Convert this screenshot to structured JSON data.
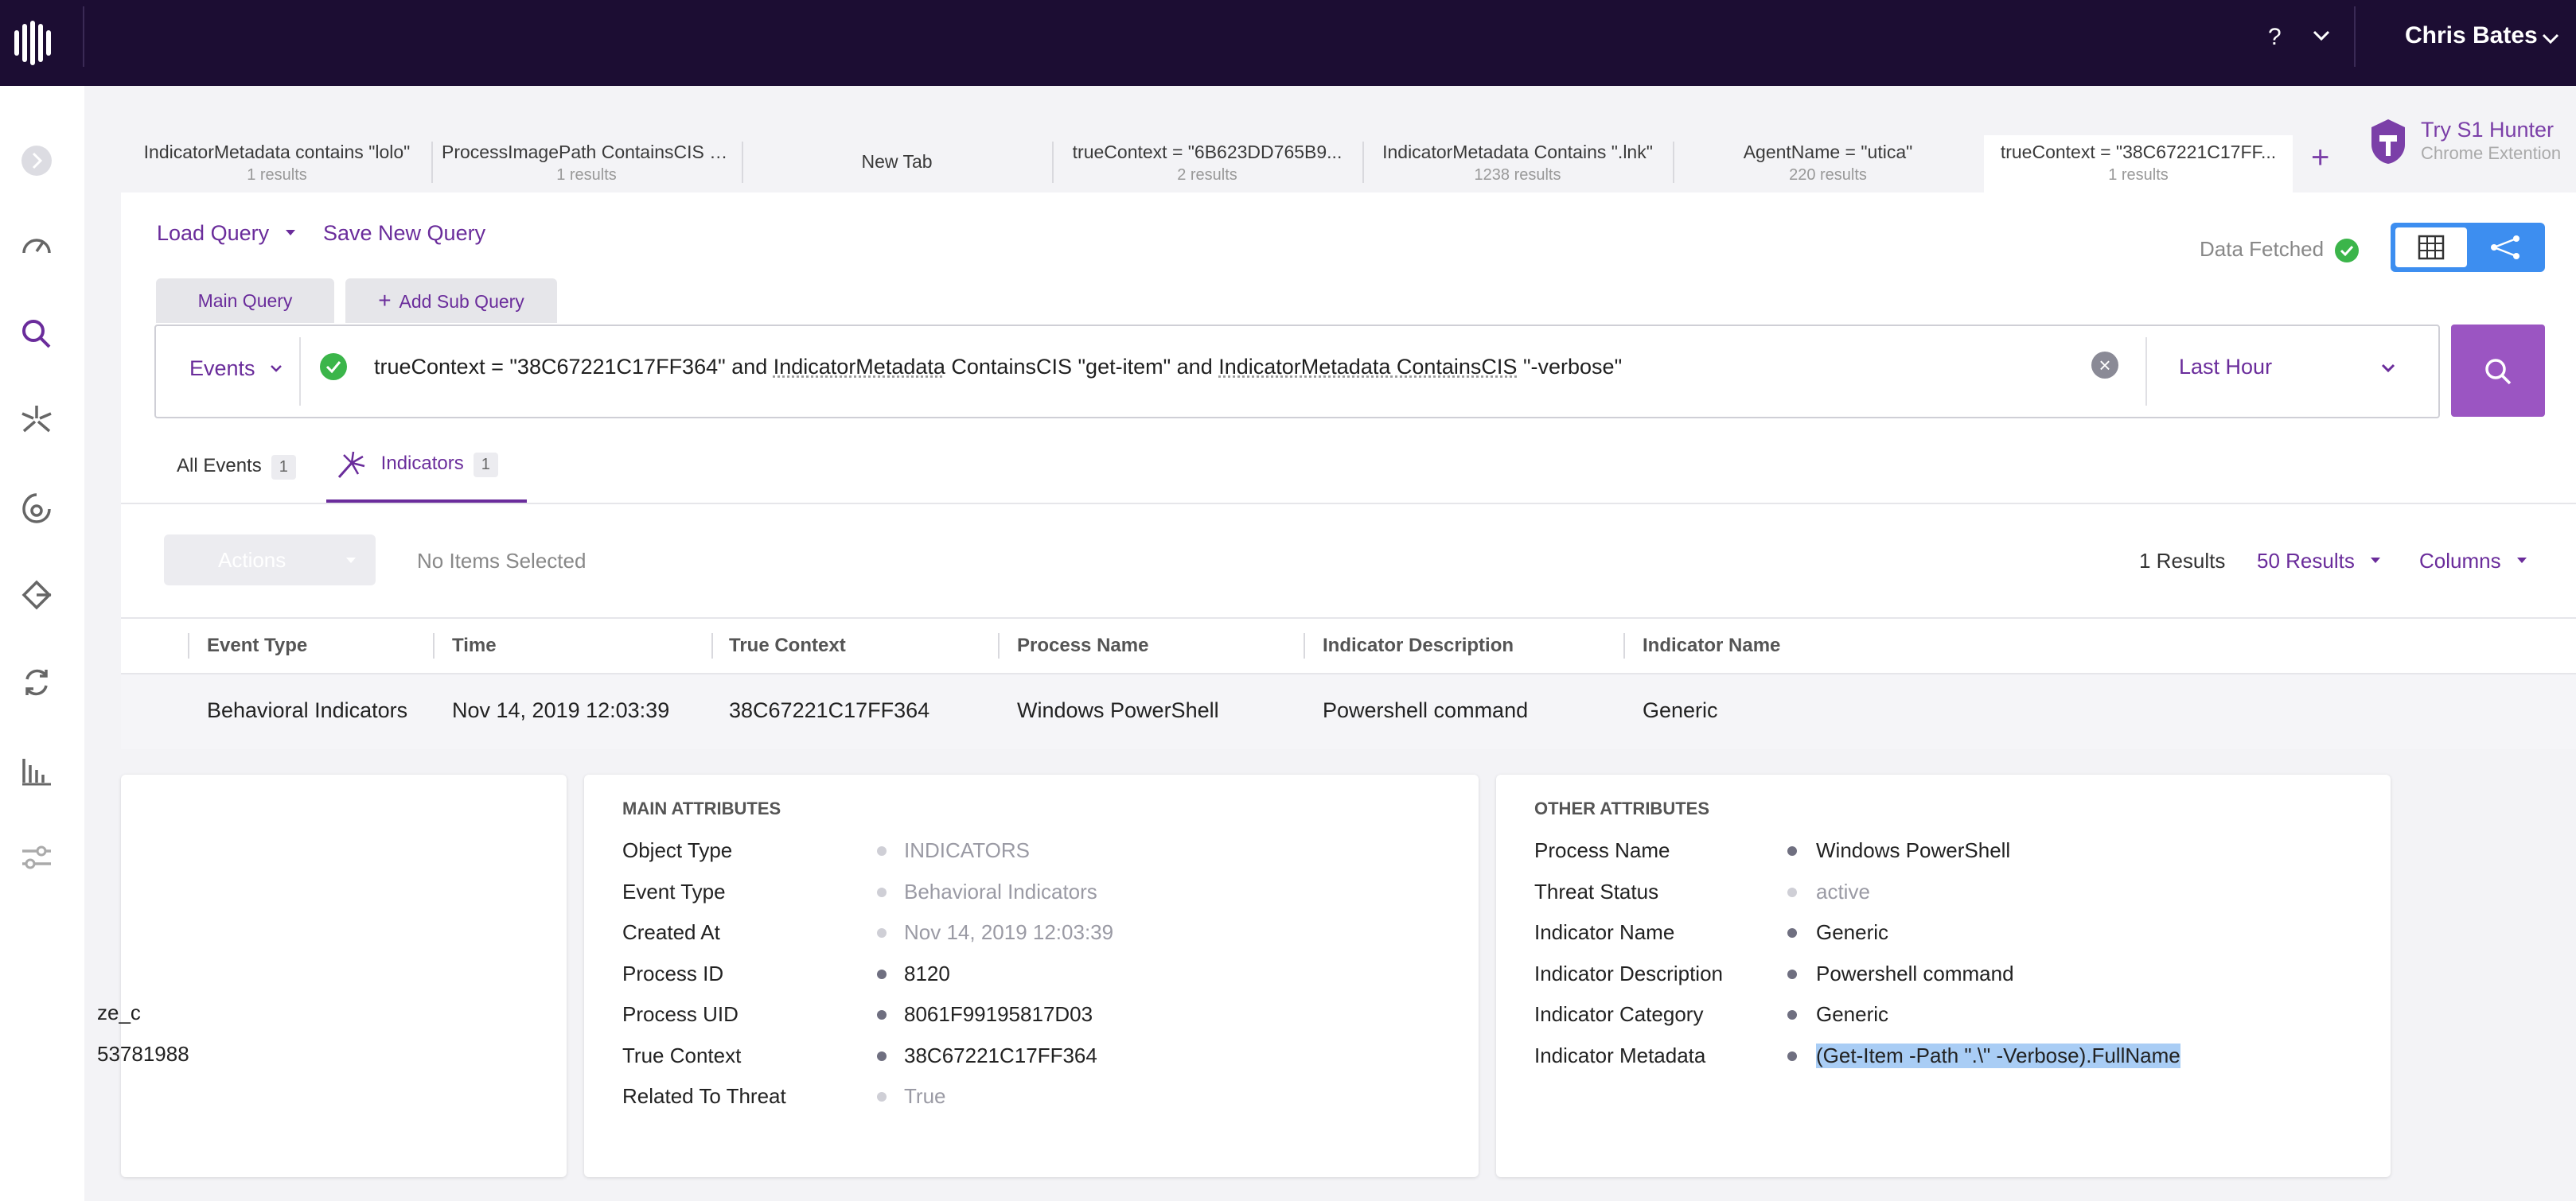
{
  "topbar": {
    "help": "?",
    "user_name": "Chris Bates"
  },
  "tabs": [
    {
      "title": "IndicatorMetadata contains \"lolo\"",
      "sub": "1 results"
    },
    {
      "title": "ProcessImagePath ContainsCIS \"j...",
      "sub": "1 results"
    },
    {
      "title": "New Tab",
      "sub": ""
    },
    {
      "title": "trueContext = \"6B623DD765B9...",
      "sub": "2 results"
    },
    {
      "title": "IndicatorMetadata Contains \".lnk\"",
      "sub": "1238 results"
    },
    {
      "title": "AgentName = \"utica\"",
      "sub": "220 results"
    },
    {
      "title": "trueContext = \"38C67221C17FF...",
      "sub": "1 results"
    }
  ],
  "add_tab": "+",
  "s1hunter": {
    "title": "Try S1 Hunter",
    "subtitle": "Chrome Extention"
  },
  "query": {
    "load_query": "Load Query",
    "save_query": "Save New Query",
    "data_fetched": "Data Fetched",
    "subtabs": {
      "main": "Main Query",
      "add": "Add Sub Query"
    },
    "scope": "Events",
    "text_parts": [
      "trueContext = \"38C67221C17FF364\" and ",
      "IndicatorMetadata",
      " ContainsCIS \"get-item\" and ",
      "IndicatorMetadata",
      " ContainsCIS",
      " \"-verbose\""
    ],
    "clear": "×",
    "time_range": "Last Hour"
  },
  "result_tabs": [
    {
      "label": "All Events",
      "count": "1"
    },
    {
      "label": "Indicators",
      "count": "1"
    }
  ],
  "toolbar": {
    "actions": "Actions",
    "selection": "No Items Selected",
    "results_count": "1 Results",
    "per_page": "50 Results",
    "columns": "Columns"
  },
  "table": {
    "headers": [
      "Event Type",
      "Time",
      "True Context",
      "Process Name",
      "Indicator Description",
      "Indicator Name"
    ],
    "row": [
      "Behavioral Indicators",
      "Nov 14, 2019 12:03:39",
      "38C67221C17FF364",
      "Windows PowerShell",
      "Powershell command",
      "Generic"
    ]
  },
  "left_card": {
    "line1": "ze_c",
    "line2": "53781988"
  },
  "main_attributes": {
    "title": "MAIN ATTRIBUTES",
    "items": [
      {
        "k": "Object Type",
        "v": "INDICATORS",
        "muted": true
      },
      {
        "k": "Event Type",
        "v": "Behavioral Indicators",
        "muted": true
      },
      {
        "k": "Created At",
        "v": "Nov 14, 2019 12:03:39",
        "muted": true
      },
      {
        "k": "Process ID",
        "v": "8120",
        "muted": false
      },
      {
        "k": "Process UID",
        "v": "8061F99195817D03",
        "muted": false
      },
      {
        "k": "True Context",
        "v": "38C67221C17FF364",
        "muted": false
      },
      {
        "k": "Related To Threat",
        "v": "True",
        "muted": true
      }
    ]
  },
  "other_attributes": {
    "title": "OTHER ATTRIBUTES",
    "items": [
      {
        "k": "Process Name",
        "v": "Windows PowerShell",
        "muted": false
      },
      {
        "k": "Threat Status",
        "v": "active",
        "muted": true
      },
      {
        "k": "Indicator Name",
        "v": "Generic",
        "muted": false
      },
      {
        "k": "Indicator Description",
        "v": "Powershell command",
        "muted": false
      },
      {
        "k": "Indicator Category",
        "v": "Generic",
        "muted": false
      },
      {
        "k": "Indicator Metadata",
        "v": "(Get-Item -Path \".\\\" -Verbose).FullName",
        "muted": false
      }
    ]
  },
  "colors": {
    "brand": "#1c0d33",
    "accent": "#6a2c9b",
    "search": "#9b55c2",
    "toggle": "#3d8ef0",
    "success": "#3bb54a"
  }
}
